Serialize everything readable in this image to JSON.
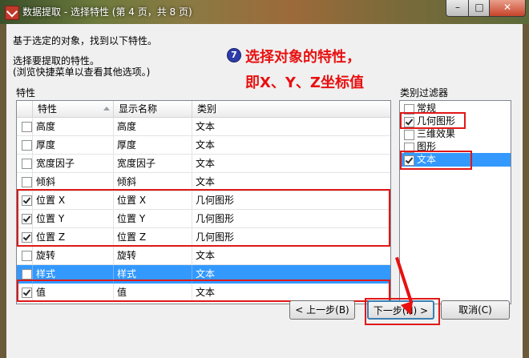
{
  "window": {
    "title": "数据提取 - 选择特性 (第 4 页，共 8 页)",
    "min_glyph": "–",
    "max_glyph": "□",
    "close_glyph": "✕"
  },
  "intro": {
    "line1": "基于选定的对象，找到以下特性。",
    "line2": "选择要提取的特性。",
    "line3": "(浏览快捷菜单以查看其他选项。)"
  },
  "annotation": {
    "badge": "7",
    "line1": "选择对象的特性，",
    "line2": "即X、Y、Z坐标值",
    "color": "#e81010"
  },
  "properties": {
    "group_label": "特性",
    "columns": [
      "特性",
      "显示名称",
      "类别"
    ],
    "rows": [
      {
        "checked": false,
        "property": "高度",
        "display": "高度",
        "category": "文本",
        "selected": false
      },
      {
        "checked": false,
        "property": "厚度",
        "display": "厚度",
        "category": "文本",
        "selected": false
      },
      {
        "checked": false,
        "property": "宽度因子",
        "display": "宽度因子",
        "category": "文本",
        "selected": false
      },
      {
        "checked": false,
        "property": "倾斜",
        "display": "倾斜",
        "category": "文本",
        "selected": false
      },
      {
        "checked": true,
        "property": "位置 X",
        "display": "位置 X",
        "category": "几何图形",
        "selected": false
      },
      {
        "checked": true,
        "property": "位置 Y",
        "display": "位置 Y",
        "category": "几何图形",
        "selected": false
      },
      {
        "checked": true,
        "property": "位置 Z",
        "display": "位置 Z",
        "category": "几何图形",
        "selected": false
      },
      {
        "checked": false,
        "property": "旋转",
        "display": "旋转",
        "category": "文本",
        "selected": false
      },
      {
        "checked": false,
        "property": "样式",
        "display": "样式",
        "category": "文本",
        "selected": true
      },
      {
        "checked": true,
        "property": "值",
        "display": "值",
        "category": "文本",
        "selected": false
      }
    ]
  },
  "category_filter": {
    "label": "类别过滤器",
    "items": [
      {
        "label": "常规",
        "checked": false,
        "selected": false
      },
      {
        "label": "几何图形",
        "checked": true,
        "selected": false
      },
      {
        "label": "三维效果",
        "checked": false,
        "selected": false
      },
      {
        "label": "图形",
        "checked": false,
        "selected": false
      },
      {
        "label": "文本",
        "checked": true,
        "selected": true
      }
    ]
  },
  "buttons": {
    "back": "< 上一步(B)",
    "next": "下一步(N) >",
    "cancel": "取消(C)"
  },
  "colors": {
    "selection": "#3399ff",
    "highlight_box": "#e01818"
  }
}
